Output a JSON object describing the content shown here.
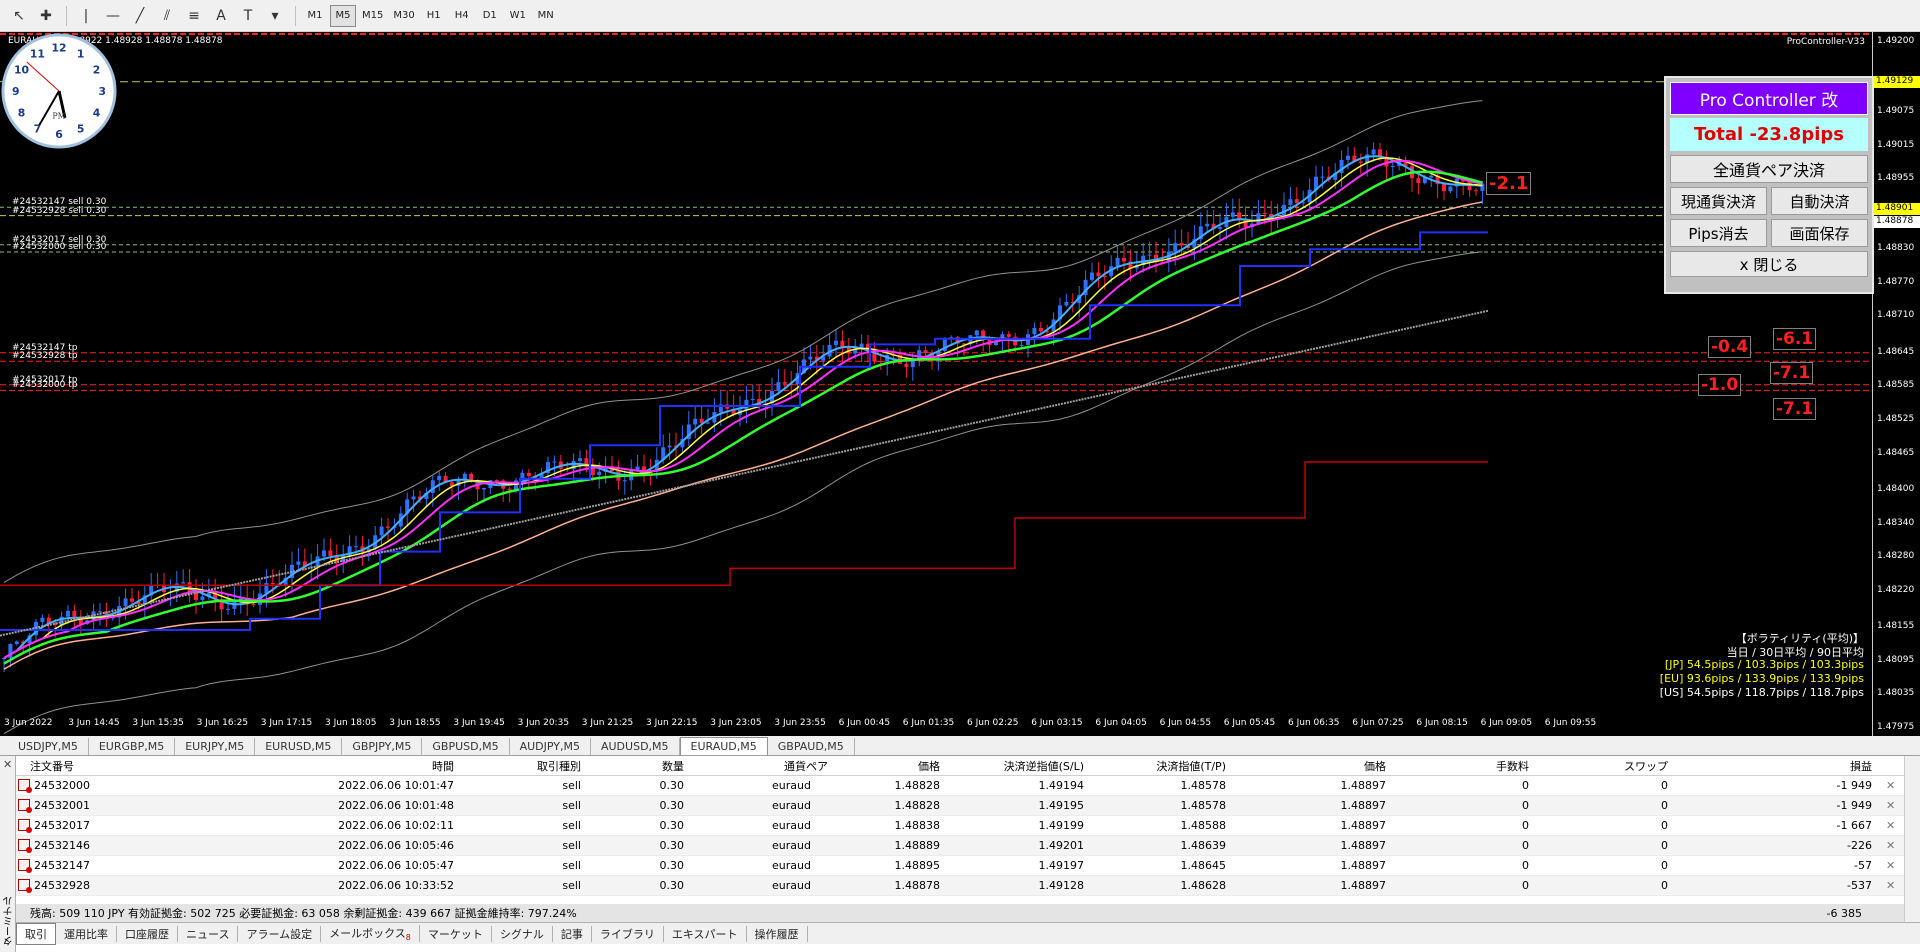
{
  "toolbar": {
    "timeframes": [
      "M1",
      "M5",
      "M15",
      "M30",
      "H1",
      "H4",
      "D1",
      "W1",
      "MN"
    ],
    "active_timeframe": "M5"
  },
  "chart": {
    "title": "EURAUD,M5  1.48922 1.48928 1.48878 1.48878",
    "pc_label": "ProController-V33",
    "order_labels": [
      {
        "text": "#24532928 sl",
        "y_price": 1.49129
      },
      {
        "text": "#24532147 sell 0.30",
        "y_price": 1.48905
      },
      {
        "text": "#24532928 sell 0.30",
        "y_price": 1.4889
      },
      {
        "text": "#24532017 sell 0.30",
        "y_price": 1.48838
      },
      {
        "text": "#24532000 sell 0.30",
        "y_price": 1.48825
      },
      {
        "text": "#24532147 tp",
        "y_price": 1.48645
      },
      {
        "text": "#24532928 tp",
        "y_price": 1.4863
      },
      {
        "text": "#24532017 tp",
        "y_price": 1.48588
      },
      {
        "text": "#24532000 tp",
        "y_price": 1.48578
      }
    ],
    "price_ticks": [
      "1.49200",
      "1.49129",
      "1.49075",
      "1.49015",
      "1.48955",
      "1.48901",
      "1.48878",
      "1.48830",
      "1.48770",
      "1.48710",
      "1.48645",
      "1.48585",
      "1.48525",
      "1.48465",
      "1.48400",
      "1.48340",
      "1.48280",
      "1.48220",
      "1.48155",
      "1.48095",
      "1.48035",
      "1.47975"
    ],
    "price_tags": [
      {
        "text": "1.49129",
        "bg": "#ffff00"
      },
      {
        "text": "1.48901",
        "bg": "#ffff00"
      },
      {
        "text": "1.48878",
        "bg": "#ffffff"
      }
    ],
    "time_ticks": [
      "3 Jun 2022",
      "3 Jun 14:45",
      "3 Jun 15:35",
      "3 Jun 16:25",
      "3 Jun 17:15",
      "3 Jun 18:05",
      "3 Jun 18:55",
      "3 Jun 19:45",
      "3 Jun 20:35",
      "3 Jun 21:25",
      "3 Jun 22:15",
      "3 Jun 23:05",
      "3 Jun 23:55",
      "6 Jun 00:45",
      "6 Jun 01:35",
      "6 Jun 02:25",
      "6 Jun 03:15",
      "6 Jun 04:05",
      "6 Jun 04:55",
      "6 Jun 05:45",
      "6 Jun 06:35",
      "6 Jun 07:25",
      "6 Jun 08:15",
      "6 Jun 09:05",
      "6 Jun 09:55"
    ],
    "current_pips_label": "-2.1",
    "pips_boxes": [
      "-0.4",
      "-6.1",
      "-1.0",
      "-7.1",
      "-7.1"
    ],
    "volatility": {
      "title": "【ボラティリティ(平均)】",
      "header": "当日 / 30日平均 / 90日平均",
      "jp": "[JP] 54.5pips / 103.3pips / 103.3pips",
      "eu": "[EU] 93.6pips / 133.9pips / 133.9pips",
      "us": "[US] 54.5pips / 118.7pips / 118.7pips",
      "colors": {
        "jp": "#ffff00",
        "eu": "#ffff00",
        "us": "#ffffff",
        "header": "#ffffff"
      }
    },
    "clock": {
      "hour": 5,
      "minute": 35,
      "second": 52,
      "ampm": "PM"
    }
  },
  "pro_controller": {
    "title": "Pro Controller 改",
    "total": "Total   -23.8pips",
    "all_close": "全通貨ペア決済",
    "current_close": "現通貨決済",
    "auto_close": "自動決済",
    "pips_clear": "Pips消去",
    "save_screen": "画面保存",
    "close": "x 閉じる"
  },
  "symbol_tabs": [
    "USDJPY,M5",
    "EURGBP,M5",
    "EURJPY,M5",
    "EURUSD,M5",
    "GBPJPY,M5",
    "GBPUSD,M5",
    "AUDJPY,M5",
    "AUDUSD,M5",
    "EURAUD,M5",
    "GBPAUD,M5"
  ],
  "active_symbol_tab": "EURAUD,M5",
  "terminal": {
    "side_label": "ターミナル",
    "headers": [
      "注文番号",
      "時間",
      "取引種別",
      "数量",
      "通貨ペア",
      "価格",
      "決済逆指値(S/L)",
      "決済指値(T/P)",
      "価格",
      "手数料",
      "スワップ",
      "損益"
    ],
    "rows": [
      [
        "24532000",
        "2022.06.06 10:01:47",
        "sell",
        "0.30",
        "euraud",
        "1.48828",
        "1.49194",
        "1.48578",
        "1.48897",
        "0",
        "0",
        "-1 949"
      ],
      [
        "24532001",
        "2022.06.06 10:01:48",
        "sell",
        "0.30",
        "euraud",
        "1.48828",
        "1.49195",
        "1.48578",
        "1.48897",
        "0",
        "0",
        "-1 949"
      ],
      [
        "24532017",
        "2022.06.06 10:02:11",
        "sell",
        "0.30",
        "euraud",
        "1.48838",
        "1.49199",
        "1.48588",
        "1.48897",
        "0",
        "0",
        "-1 667"
      ],
      [
        "24532146",
        "2022.06.06 10:05:46",
        "sell",
        "0.30",
        "euraud",
        "1.48889",
        "1.49201",
        "1.48639",
        "1.48897",
        "0",
        "0",
        "-226"
      ],
      [
        "24532147",
        "2022.06.06 10:05:47",
        "sell",
        "0.30",
        "euraud",
        "1.48895",
        "1.49197",
        "1.48645",
        "1.48897",
        "0",
        "0",
        "-57"
      ],
      [
        "24532928",
        "2022.06.06 10:33:52",
        "sell",
        "0.30",
        "euraud",
        "1.48878",
        "1.49128",
        "1.48628",
        "1.48897",
        "0",
        "0",
        "-537"
      ]
    ],
    "summary": "残高: 509 110 JPY  有効証拠金: 502 725  必要証拠金: 63 058  余剰証拠金: 439 667  証拠金維持率: 797.24%",
    "summary_total": "-6 385",
    "tabs": [
      "取引",
      "運用比率",
      "口座履歴",
      "ニュース",
      "アラーム設定",
      "メールボックス",
      "マーケット",
      "シグナル",
      "記事",
      "ライブラリ",
      "エキスパート",
      "操作履歴"
    ],
    "active_tab": "取引",
    "mailbox_badge": "8"
  }
}
